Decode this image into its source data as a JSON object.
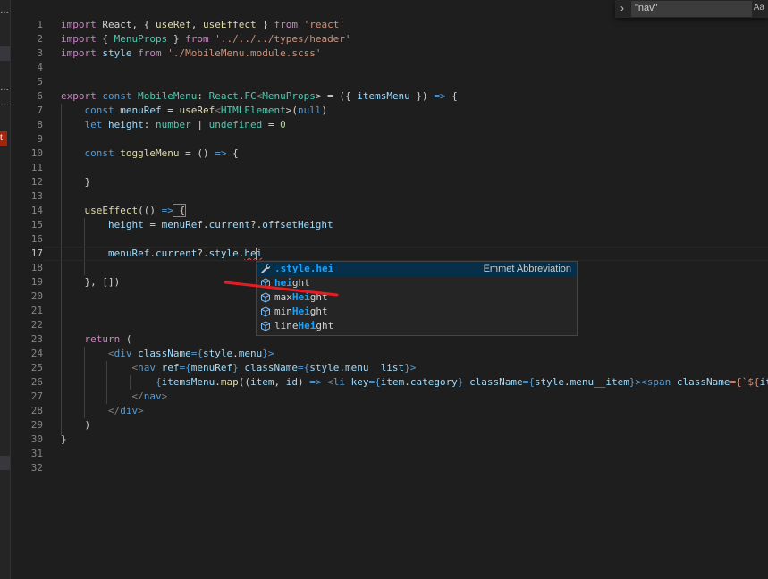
{
  "sidebar": {
    "frag1": "…",
    "frag2": "…",
    "frag3": "…",
    "badge": "t"
  },
  "find": {
    "query": "\"nav\"",
    "match_case_label": "Aa"
  },
  "line_numbers": [
    "1",
    "2",
    "3",
    "4",
    "5",
    "6",
    "7",
    "8",
    "9",
    "10",
    "11",
    "12",
    "13",
    "14",
    "15",
    "16",
    "17",
    "18",
    "19",
    "20",
    "21",
    "22",
    "23",
    "24",
    "25",
    "26",
    "27",
    "28",
    "29",
    "30",
    "31",
    "32"
  ],
  "code": {
    "l1": [
      "import",
      " React, { ",
      "useRef",
      ", ",
      "useEffect",
      " } ",
      "from",
      " ",
      "'react'"
    ],
    "l2": [
      "import",
      " { ",
      "MenuProps",
      " } ",
      "from",
      " ",
      "'../../../types/header'"
    ],
    "l3": [
      "import",
      " ",
      "style",
      " ",
      "from",
      " ",
      "'./MobileMenu.module.scss'"
    ],
    "l6": [
      "export",
      " ",
      "const",
      " ",
      "MobileMenu",
      ": ",
      "React",
      ".",
      "FC",
      "<",
      "MenuProps",
      "> = ({ ",
      "itemsMenu",
      " }) ",
      "=>",
      " {"
    ],
    "l7": [
      "const",
      " ",
      "menuRef",
      " = ",
      "useRef",
      "<",
      "HTMLElement",
      ">(",
      "null",
      ")"
    ],
    "l8": [
      "let",
      " ",
      "height",
      ": ",
      "number",
      " | ",
      "undefined",
      " = ",
      "0"
    ],
    "l10": [
      "const",
      " ",
      "toggleMenu",
      " = () ",
      "=>",
      " {"
    ],
    "l12": [
      "}"
    ],
    "l14": [
      "useEffect",
      "(() ",
      "=>",
      " {"
    ],
    "l15": [
      "height",
      " = ",
      "menuRef",
      ".",
      "current",
      "?.",
      "offsetHeight"
    ],
    "l17": [
      "menuRef",
      ".",
      "current",
      "?.",
      "style",
      ".",
      "hei"
    ],
    "l19": [
      "}, [])"
    ],
    "l23": [
      "return",
      " ("
    ],
    "l24": [
      "<",
      "div",
      " ",
      "className",
      "={",
      "style",
      ".",
      "menu",
      "}>"
    ],
    "l25": [
      "<",
      "nav",
      " ",
      "ref",
      "={",
      "menuRef",
      "} ",
      "className",
      "={",
      "style",
      ".",
      "menu__list",
      "}>"
    ],
    "l26": [
      "{",
      "itemsMenu",
      ".",
      "map",
      "((",
      "item",
      ", ",
      "id",
      ") ",
      "=>",
      " <",
      "li",
      " ",
      "key",
      "={",
      "item",
      ".",
      "category",
      "} ",
      "className",
      "={",
      "style",
      ".",
      "menu__item",
      "}><",
      "span",
      " ",
      "className",
      "={`${",
      "item",
      ".",
      "i"
    ],
    "l27": [
      "</",
      "nav",
      ">"
    ],
    "l28": [
      "</",
      "div",
      ">"
    ],
    "l29": [
      ")"
    ],
    "l30": [
      "}"
    ]
  },
  "suggest": {
    "items": [
      {
        "pre": "",
        "hl": ".style.hei",
        "post": "",
        "icon": "wrench-icon",
        "detail": "Emmet Abbreviation"
      },
      {
        "pre": "",
        "hl": "hei",
        "post": "ght",
        "icon": "cube-icon",
        "detail": ""
      },
      {
        "pre": "max",
        "hl": "Hei",
        "post": "ght",
        "icon": "cube-icon",
        "detail": ""
      },
      {
        "pre": "min",
        "hl": "Hei",
        "post": "ght",
        "icon": "cube-icon",
        "detail": ""
      },
      {
        "pre": "line",
        "hl": "Hei",
        "post": "ght",
        "icon": "cube-icon",
        "detail": ""
      }
    ]
  },
  "colors": {
    "background": "#1e1e1e",
    "keyword": "#569cd6",
    "control": "#c586c0",
    "string": "#ce9178",
    "variable": "#9cdcfe",
    "function": "#dcdcaa",
    "type": "#4ec9b0",
    "highlight": "#18a3ff",
    "annotation": "#e51c23"
  }
}
